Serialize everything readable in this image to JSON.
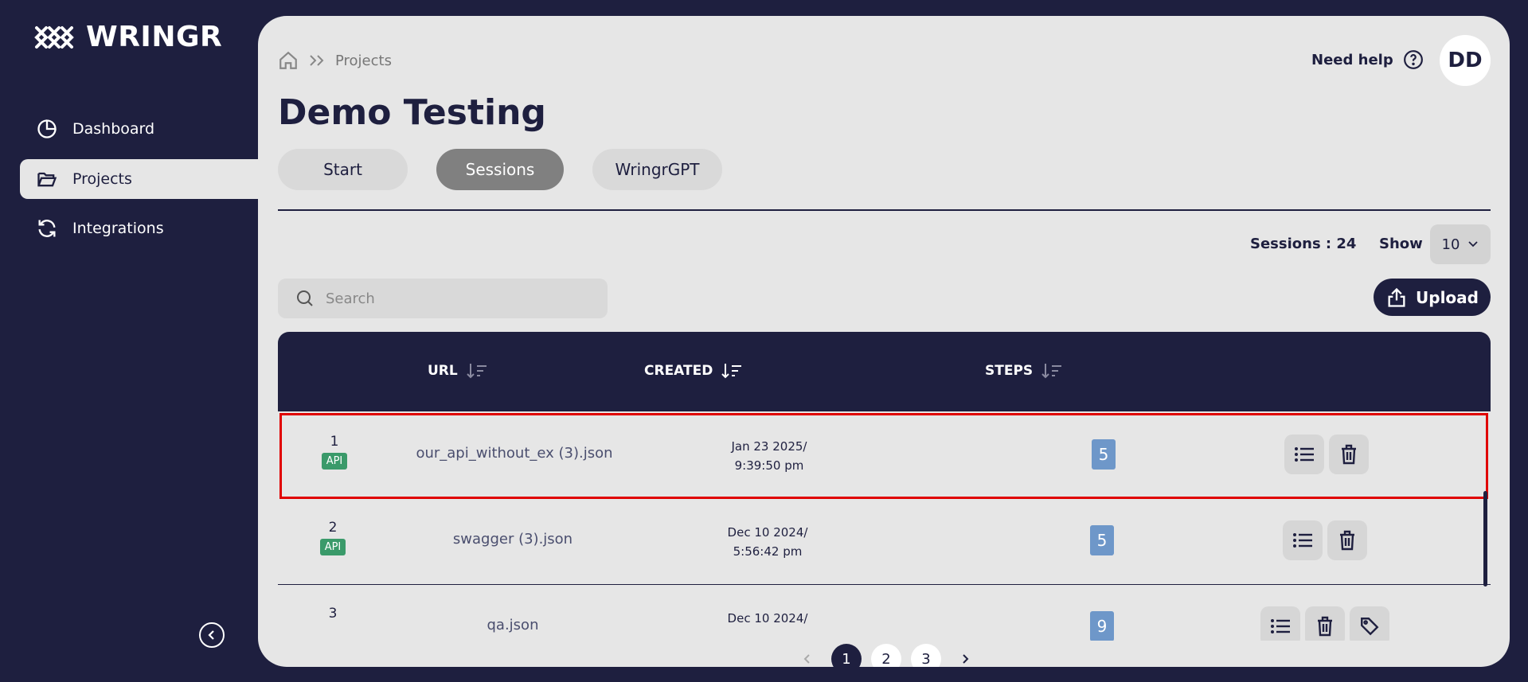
{
  "brand": {
    "name": "WRINGR"
  },
  "sidebar": {
    "items": [
      {
        "label": "Dashboard",
        "icon": "pie-chart-icon",
        "active": false
      },
      {
        "label": "Projects",
        "icon": "folder-open-icon",
        "active": true
      },
      {
        "label": "Integrations",
        "icon": "refresh-icon",
        "active": false
      }
    ]
  },
  "header": {
    "breadcrumb": [
      "Projects"
    ],
    "help_label": "Need help",
    "avatar_initials": "DD"
  },
  "page": {
    "title": "Demo Testing"
  },
  "tabs": [
    {
      "label": "Start",
      "active": false
    },
    {
      "label": "Sessions",
      "active": true
    },
    {
      "label": "WringrGPT",
      "active": false
    }
  ],
  "toolbar": {
    "sessions_count": "Sessions : 24",
    "show_label": "Show",
    "show_value": "10",
    "search_placeholder": "Search",
    "upload_label": "Upload"
  },
  "table": {
    "columns": [
      "URL",
      "CREATED",
      "STEPS"
    ],
    "rows": [
      {
        "num": "1",
        "type": "API",
        "url": "our_api_without_ex (3).json",
        "created_date": "Jan 23 2025/",
        "created_time": "9:39:50 pm",
        "steps": "5"
      },
      {
        "num": "2",
        "type": "API",
        "url": "swagger (3).json",
        "created_date": "Dec 10 2024/",
        "created_time": "5:56:42 pm",
        "steps": "5"
      },
      {
        "num": "3",
        "type": "",
        "url": "qa.json",
        "created_date": "Dec 10 2024/",
        "created_time": "",
        "steps": "9"
      }
    ]
  },
  "pagination": {
    "pages": [
      "1",
      "2",
      "3"
    ],
    "current": "1"
  },
  "colors": {
    "navy": "#1e1f3f",
    "panel": "#e6e6e6",
    "api_badge": "#3a9a6a",
    "steps_badge": "#6e97c9",
    "highlight": "#e00000"
  }
}
